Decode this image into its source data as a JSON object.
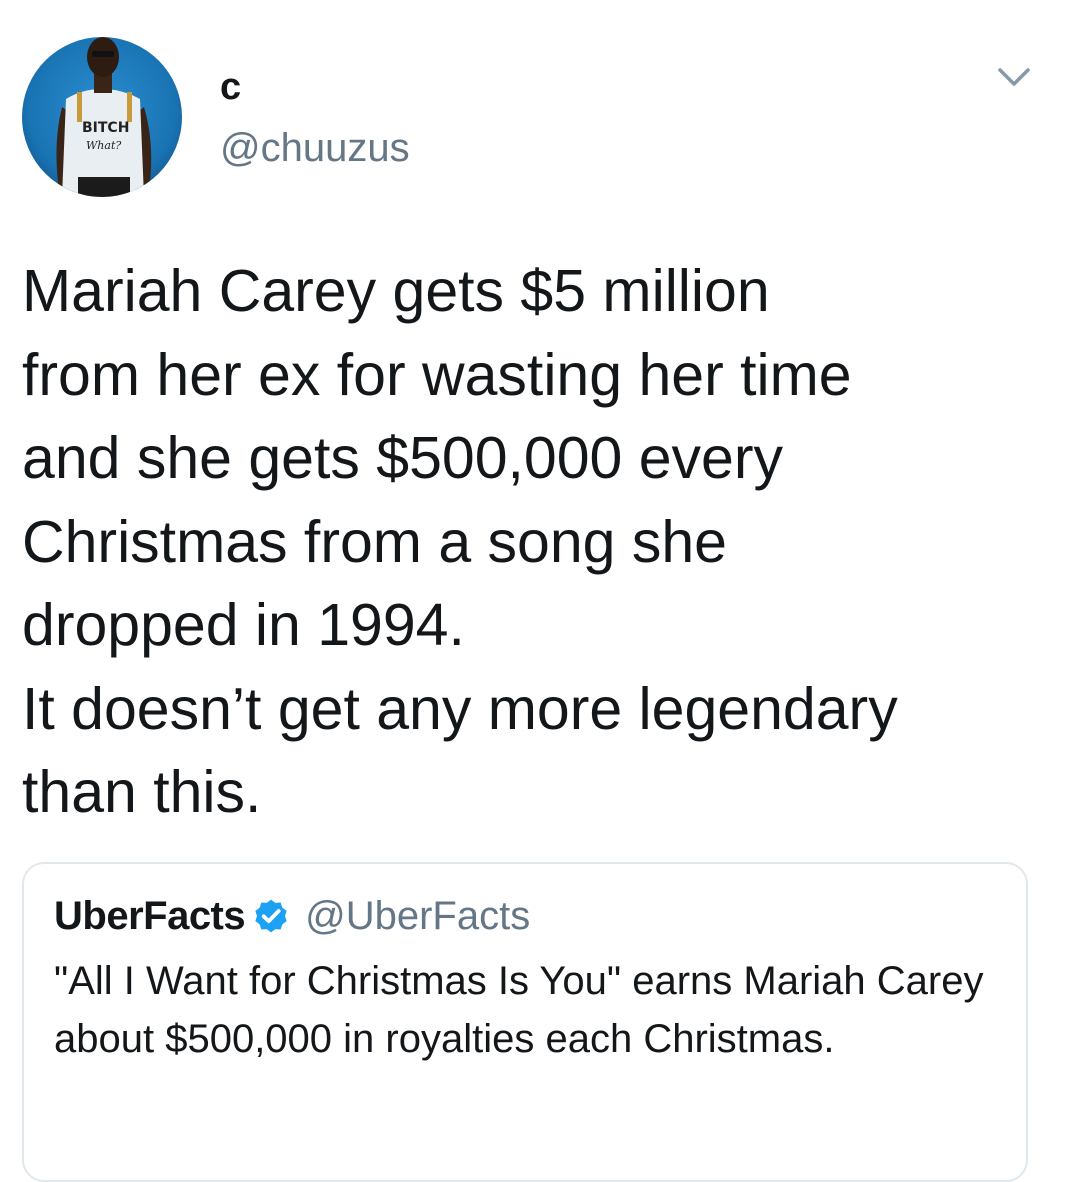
{
  "tweet": {
    "author_display_name": "c",
    "author_handle": "@chuuzus",
    "avatar_shirt_text_line1": "BITCH",
    "avatar_shirt_text_line2": "What?",
    "text": "Mariah Carey gets $5 million\nfrom her ex for wasting her time\nand she gets $500,000 every\nChristmas from a song she\ndropped in 1994.\nIt doesn’t get any more legendary\nthan this."
  },
  "quoted_tweet": {
    "author_display_name": "UberFacts",
    "author_handle": "@UberFacts",
    "verified": true,
    "text": "\"All I Want for Christmas Is You\" earns Mariah Carey about $500,000 in royalties each Christmas."
  },
  "icons": {
    "menu": "chevron-down-icon",
    "verified": "verified-badge-icon"
  },
  "colors": {
    "text_primary": "#14171a",
    "text_secondary": "#657786",
    "verified_blue": "#1da1f2",
    "card_border": "#e1e8ed",
    "avatar_background": "#1a78b8"
  }
}
